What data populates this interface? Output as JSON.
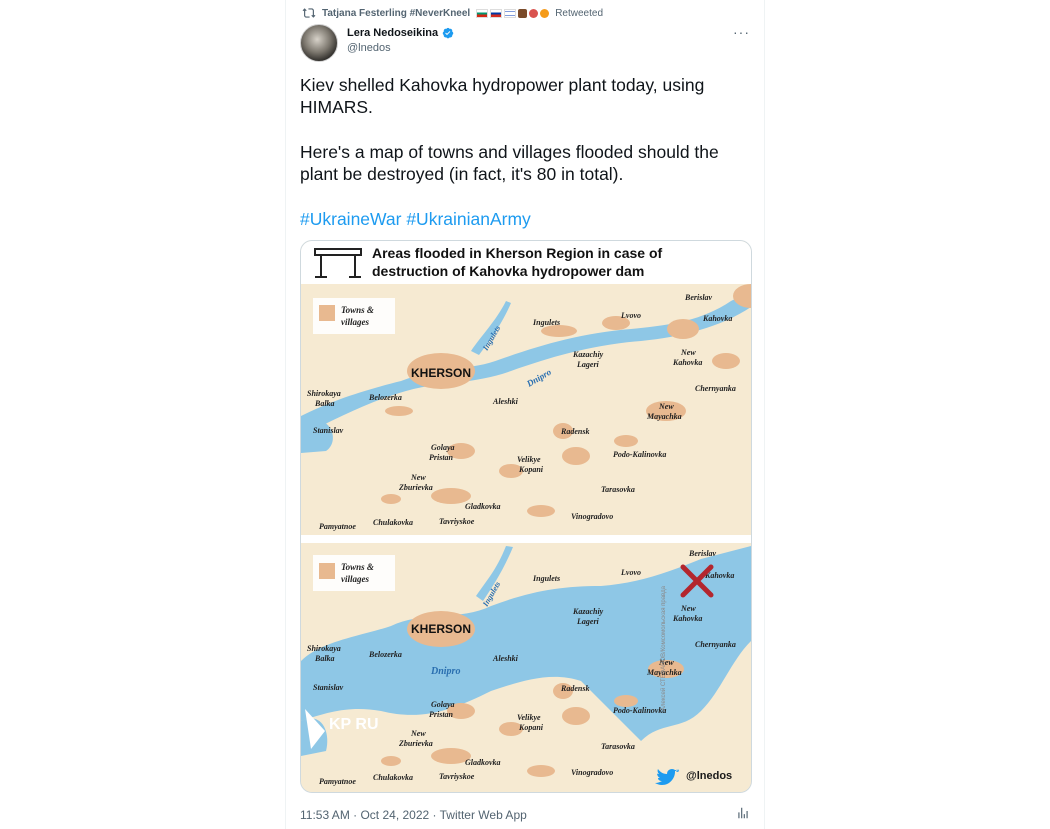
{
  "retweet": {
    "user": "Tatjana Festerling #NeverKneel",
    "suffix": "Retweeted"
  },
  "author": {
    "display_name": "Lera Nedoseikina",
    "handle": "@lnedos"
  },
  "tweet": {
    "line1": "Kiev shelled Kahovka hydropower plant today, using HIMARS.",
    "line2": "Here's a map of towns and villages flooded should the plant be destroyed (in fact, it's 80 in total).",
    "hashtags": "#UkraineWar #UkrainianArmy"
  },
  "map": {
    "title_line1": "Areas flooded in Kherson Region in case of",
    "title_line2": "destruction of Kahovka hydropower dam",
    "legend_line1": "Towns &",
    "legend_line2": "villages",
    "labels": {
      "berislav": "Berislav",
      "kahovka": "Kahovka",
      "lvovo": "Lvovo",
      "ingulets_town": "Ingulets",
      "ingulets_river": "Ingulets",
      "kazachiy": "Kazachiy",
      "lageri": "Lageri",
      "new": "New",
      "kahovka2": "Kahovka",
      "kherson": "KHERSON",
      "dnipro": "Dnipro",
      "chernyanka": "Chernyanka",
      "shirokaya": "Shirokaya",
      "balka": "Balka",
      "belozerka": "Belozerka",
      "aleshki": "Aleshki",
      "mayachka": "Mayachka",
      "stanislav": "Stanislav",
      "radensk": "Radensk",
      "golaya": "Golaya",
      "pristan": "Pristan",
      "velikye": "Velikye",
      "kopani": "Kopani",
      "podo": "Podo-Kalinovka",
      "zburievka": "Zburievka",
      "tarasovka": "Tarasovka",
      "gladkovka": "Gladkovka",
      "pamyatnoe": "Pamyatnoe",
      "chulakovka": "Chulakovka",
      "tavriyskoe": "Tavriyskoe",
      "vinogradovo": "Vinogradovo"
    },
    "logo": "KP RU",
    "credit_handle": "@lnedos",
    "side_credit": "Алексей СТЕФАНОВ/Комсомольская правда"
  },
  "footer": {
    "meta": "11:53 AM · Oct 24, 2022 · Twitter Web App"
  },
  "colors": {
    "accent": "#1d9bf0",
    "water": "#8ec7e6",
    "land": "#f6ead2",
    "towns": "#e8b990",
    "cross": "#b3262e"
  }
}
